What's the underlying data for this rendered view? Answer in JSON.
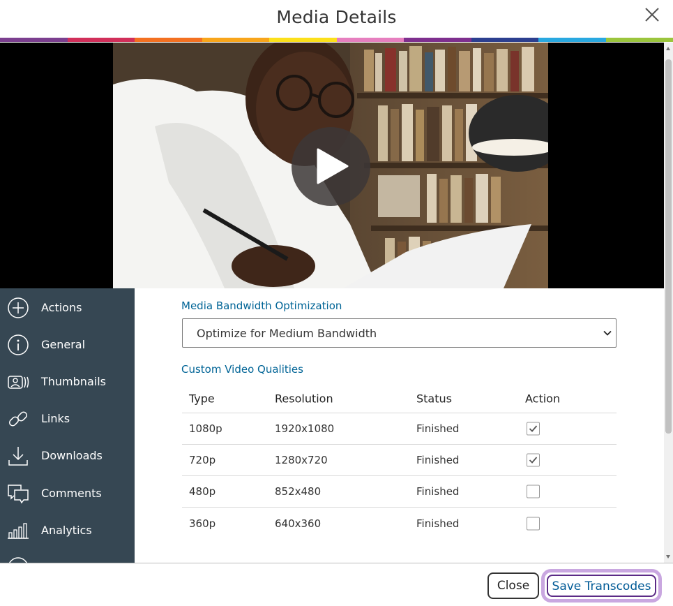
{
  "dialog": {
    "title": "Media Details"
  },
  "brand_stripe_colors": [
    "#7b3f8f",
    "#d12f5a",
    "#f37021",
    "#f8a51b",
    "#fce01b",
    "#e67fbf",
    "#7e2f8e",
    "#2c3f8f",
    "#29a8e0",
    "#9bc53d"
  ],
  "video": {
    "play_icon": "play-icon"
  },
  "sidebar": {
    "items": [
      {
        "label": "Actions",
        "icon": "plus-circle-icon"
      },
      {
        "label": "General",
        "icon": "info-circle-icon"
      },
      {
        "label": "Thumbnails",
        "icon": "thumbnails-icon"
      },
      {
        "label": "Links",
        "icon": "link-icon"
      },
      {
        "label": "Downloads",
        "icon": "download-icon"
      },
      {
        "label": "Comments",
        "icon": "comments-icon"
      },
      {
        "label": "Analytics",
        "icon": "analytics-icon"
      }
    ]
  },
  "bandwidth": {
    "title": "Media Bandwidth Optimization",
    "selected": "Optimize for Medium Bandwidth"
  },
  "qualities": {
    "title": "Custom Video Qualities",
    "headers": [
      "Type",
      "Resolution",
      "Status",
      "Action"
    ],
    "rows": [
      {
        "type": "1080p",
        "resolution": "1920x1080",
        "status": "Finished",
        "checked": true
      },
      {
        "type": "720p",
        "resolution": "1280x720",
        "status": "Finished",
        "checked": true
      },
      {
        "type": "480p",
        "resolution": "852x480",
        "status": "Finished",
        "checked": false
      },
      {
        "type": "360p",
        "resolution": "640x360",
        "status": "Finished",
        "checked": false
      }
    ]
  },
  "footer": {
    "close_label": "Close",
    "save_label": "Save Transcodes"
  },
  "colors": {
    "sidebar_bg": "#364753",
    "accent_blue": "#006496",
    "save_focus_ring": "#c9a7e0"
  }
}
